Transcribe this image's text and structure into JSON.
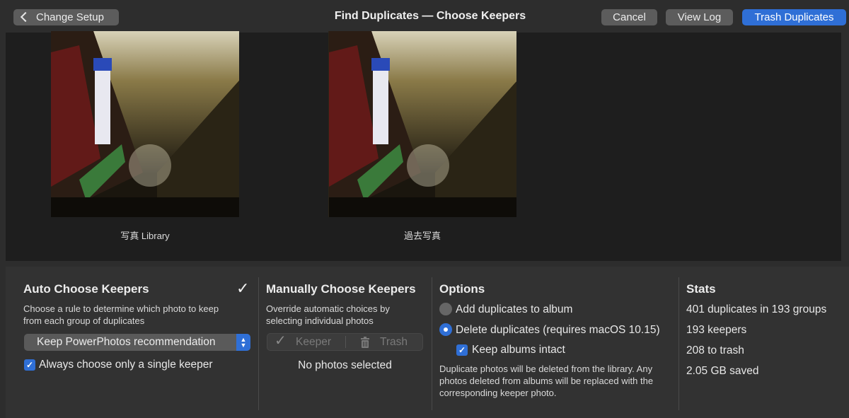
{
  "toolbar": {
    "back_label": "Change Setup",
    "title": "Find Duplicates — Choose Keepers",
    "cancel_label": "Cancel",
    "view_log_label": "View Log",
    "trash_label": "Trash Duplicates"
  },
  "photos": [
    {
      "caption": "写真 Library"
    },
    {
      "caption": "過去写真"
    }
  ],
  "auto": {
    "heading": "Auto Choose Keepers",
    "description": "Choose a rule to determine which photo to keep from each group of duplicates",
    "rule_selected": "Keep PowerPhotos recommendation",
    "single_keeper_label": "Always choose only a single keeper",
    "single_keeper_checked": true
  },
  "manual": {
    "heading": "Manually Choose Keepers",
    "description": "Override automatic choices by selecting individual photos",
    "keeper_label": "Keeper",
    "trash_label": "Trash",
    "status": "No photos selected"
  },
  "options": {
    "heading": "Options",
    "add_to_album_label": "Add duplicates to album",
    "delete_label": "Delete duplicates (requires macOS 10.15)",
    "keep_albums_label": "Keep albums intact",
    "note": "Duplicate photos will be deleted from the library. Any photos deleted from albums will be replaced with the corresponding keeper photo."
  },
  "stats": {
    "heading": "Stats",
    "duplicates": "401 duplicates in 193 groups",
    "keepers": "193 keepers",
    "to_trash": "208 to trash",
    "saved": "2.05 GB saved"
  },
  "colors": {
    "accent": "#2f6fd6",
    "background": "#2d2d2d",
    "photo_area": "#1e1e1e"
  }
}
